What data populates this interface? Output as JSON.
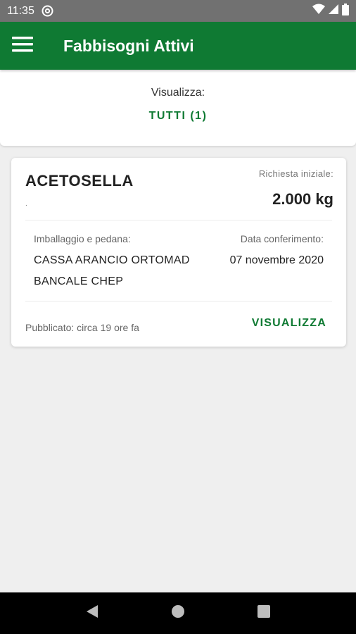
{
  "status_bar": {
    "time": "11:35",
    "icons": [
      "at-sign-icon",
      "wifi-icon",
      "signal-icon",
      "battery-icon"
    ]
  },
  "app_bar": {
    "title": "Fabbisogni Attivi",
    "menu_icon": "menu-icon",
    "color": "#0f7a33"
  },
  "filter": {
    "label": "Visualizza:",
    "value": "TUTTI (1)"
  },
  "card": {
    "product": "ACETOSELLA",
    "subtitle": ".",
    "request_label": "Richiesta iniziale:",
    "request_value": "2.000 kg",
    "packaging_label": "Imballaggio e pedana:",
    "packaging_lines": [
      "CASSA ARANCIO ORTOMAD",
      "BANCALE CHEP"
    ],
    "date_label": "Data conferimento:",
    "date_value": "07 novembre 2020",
    "published": "Pubblicato: circa 19 ore fa",
    "action": "VISUALIZZA"
  },
  "nav_bar": {
    "icons": [
      "back-icon",
      "home-icon",
      "recents-icon"
    ]
  }
}
